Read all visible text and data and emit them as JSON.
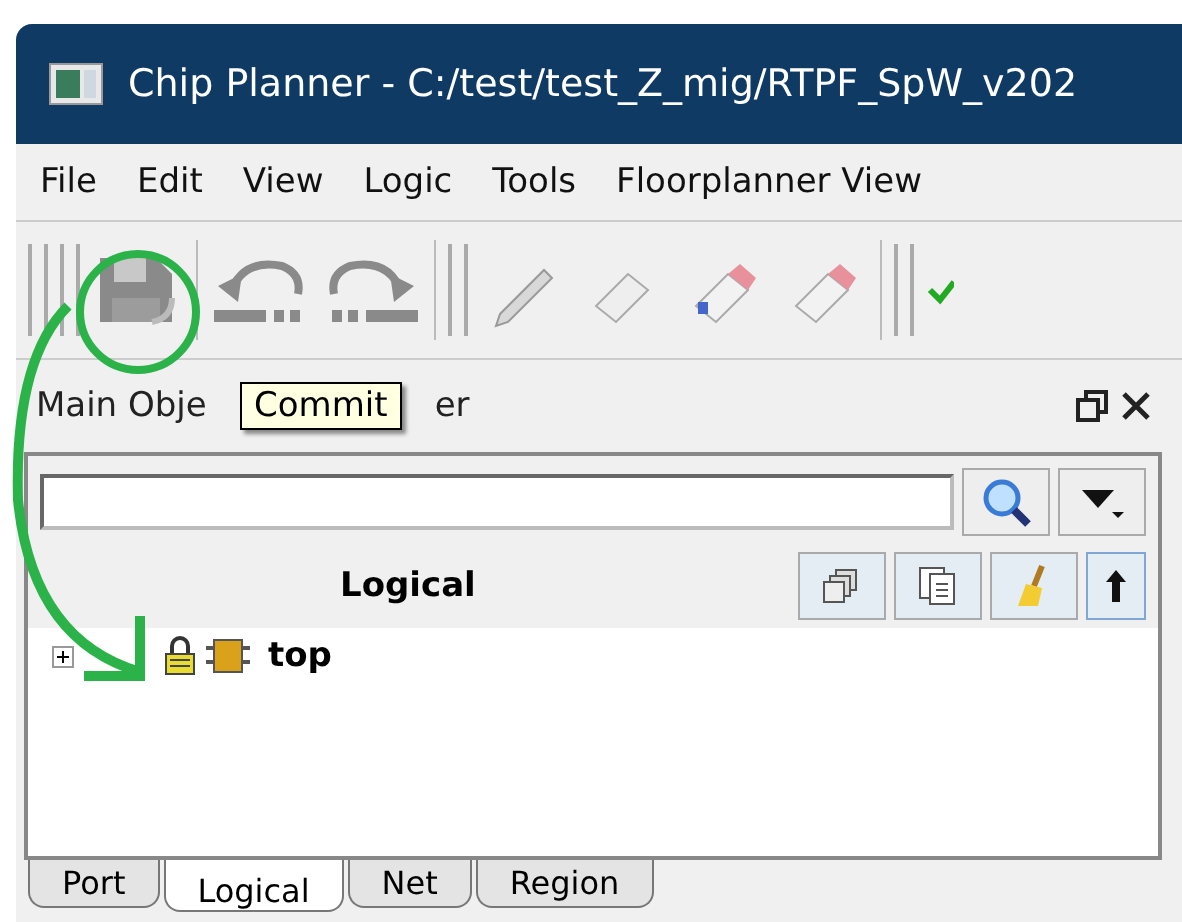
{
  "window": {
    "title": "Chip Planner - C:/test/test_Z_mig/RTPF_SpW_v202"
  },
  "menu": [
    "File",
    "Edit",
    "View",
    "Logic",
    "Tools",
    "Floorplanner View"
  ],
  "tooltip": {
    "text": "Commit"
  },
  "panel": {
    "title_start": "Main Obje",
    "title_end": "er",
    "column_header": "Logical",
    "tree": [
      {
        "label": "top",
        "expanded": false
      }
    ]
  },
  "tabs": [
    {
      "label": "Port",
      "selected": false
    },
    {
      "label": "Logical",
      "selected": true
    },
    {
      "label": "Net",
      "selected": false
    },
    {
      "label": "Region",
      "selected": false
    }
  ]
}
